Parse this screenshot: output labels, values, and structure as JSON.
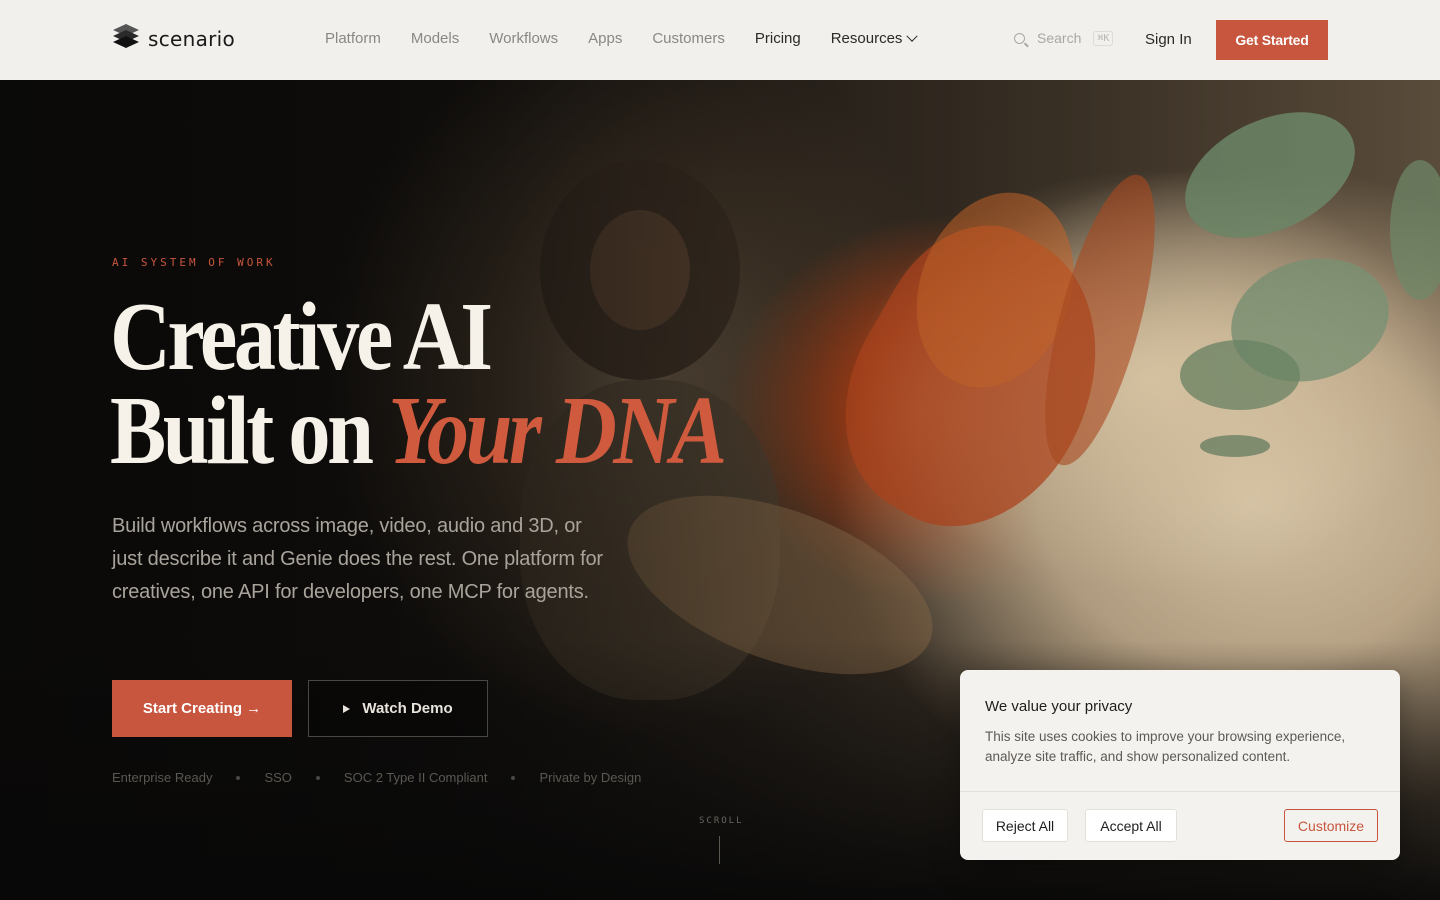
{
  "brand": {
    "name": "scenario"
  },
  "nav": {
    "items": [
      {
        "label": "Platform"
      },
      {
        "label": "Models"
      },
      {
        "label": "Workflows"
      },
      {
        "label": "Apps"
      },
      {
        "label": "Customers"
      },
      {
        "label": "Pricing"
      },
      {
        "label": "Resources"
      }
    ],
    "search_label": "Search",
    "search_shortcut": "⌘K",
    "signin_label": "Sign In",
    "cta_label": "Get Started"
  },
  "hero": {
    "eyebrow": "AI SYSTEM OF WORK",
    "title_line1": "Creative AI",
    "title_line2_plain": "Built on ",
    "title_line2_accent": "Your DNA",
    "lead": "Build workflows across image, video, audio and 3D, or just describe it and Genie does the rest. One platform for creatives, one API for developers, one MCP for agents.",
    "primary_cta": "Start Creating →",
    "secondary_cta": "Watch Demo",
    "badges": [
      "Enterprise Ready",
      "SSO",
      "SOC 2 Type II Compliant",
      "Private by Design"
    ],
    "scroll_label": "SCROLL"
  },
  "cookie": {
    "title": "We value your privacy",
    "text": "This site uses cookies to improve your browsing experience, analyze site traffic, and show personalized content.",
    "reject_label": "Reject All",
    "accept_label": "Accept All",
    "customize_label": "Customize"
  },
  "colors": {
    "accent": "#c8553d",
    "nav_bg": "#f1f0ec"
  }
}
